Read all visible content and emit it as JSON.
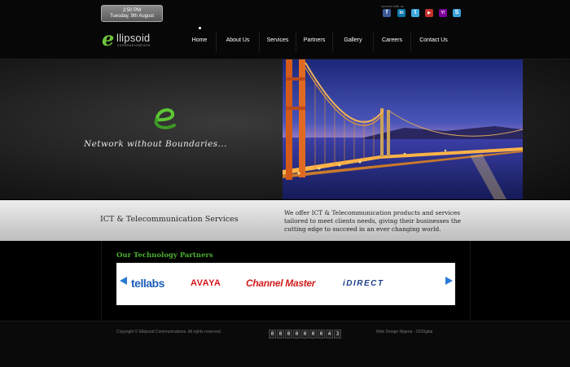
{
  "header": {
    "clock": {
      "time": "2:50 PM",
      "date": "Tuesday, 9th August"
    },
    "connect_label": "connect with us",
    "social": [
      {
        "icon": "facebook-icon",
        "glyph": "f",
        "color": "#3b5998"
      },
      {
        "icon": "linkedin-icon",
        "glyph": "in",
        "color": "#0e76a8"
      },
      {
        "icon": "twitter-icon",
        "glyph": "t",
        "color": "#3fa9e0"
      },
      {
        "icon": "youtube-icon",
        "glyph": "▶",
        "color": "#c4302b"
      },
      {
        "icon": "yahoo-icon",
        "glyph": "Y!",
        "color": "#7b0099"
      },
      {
        "icon": "skype-icon",
        "glyph": "S",
        "color": "#38a0d8"
      }
    ],
    "logo": {
      "mark": "e",
      "name": "llipsoid",
      "sub": "communications"
    },
    "nav": [
      "Home",
      "About Us",
      "Services",
      "Partners",
      "Gallery",
      "Careers",
      "Contact Us"
    ]
  },
  "hero": {
    "tagline": "Network without Boundaries..."
  },
  "services": {
    "title": "ICT & Telecommunication Services",
    "description": "We offer ICT & Telecommunication products and services tailored to meet clients needs, giving their businesses the cutting edge to succeed in an ever changing world."
  },
  "partners": {
    "title": "Our Technology Partners",
    "logos": [
      "tellabs",
      "AVAYA",
      "Channel Master",
      "iDIRECT"
    ]
  },
  "footer": {
    "copyright": "Copyright © Ellipsoid Communications. All rights reserved.",
    "counter": "000000043",
    "credit": "Web Design Nigeria : CKDigital"
  },
  "colors": {
    "accent_green": "#4caf2f",
    "background": "#000000"
  }
}
